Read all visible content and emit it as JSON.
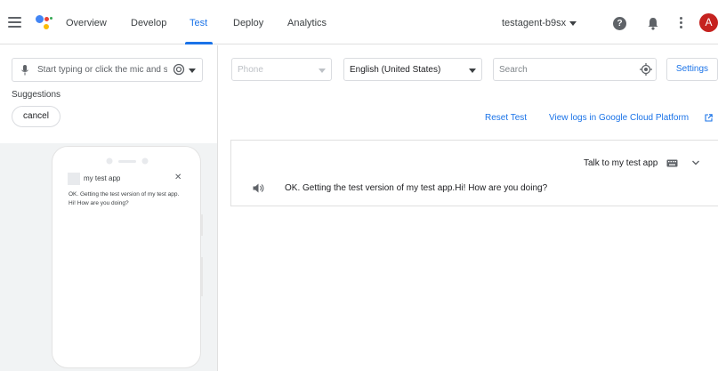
{
  "header": {
    "tabs": [
      {
        "label": "Overview"
      },
      {
        "label": "Develop"
      },
      {
        "label": "Test"
      },
      {
        "label": "Deploy"
      },
      {
        "label": "Analytics"
      }
    ],
    "active_tab": "Test",
    "agent_name": "testagent-b9sx",
    "avatar_letter": "A"
  },
  "simulator_input": {
    "placeholder": "Start typing or click the mic and start talking"
  },
  "suggestions": {
    "label": "Suggestions",
    "chips": [
      "cancel"
    ]
  },
  "phone": {
    "app_title": "my test app",
    "message": "OK. Getting the test version of my test app. Hi! How are you doing?"
  },
  "toolbar": {
    "device_placeholder": "Phone",
    "language": "English (United States)",
    "search_placeholder": "Search",
    "settings_label": "Settings"
  },
  "actions": {
    "reset_label": "Reset Test",
    "logs_label": "View logs in Google Cloud Platform"
  },
  "conversation": {
    "user_utterance": "Talk to my test app",
    "response": "OK. Getting the test version of my test app.Hi! How are you doing?"
  },
  "colors": {
    "accent": "#1a73e8",
    "avatar": "#c5221f",
    "border": "#dadce0"
  }
}
